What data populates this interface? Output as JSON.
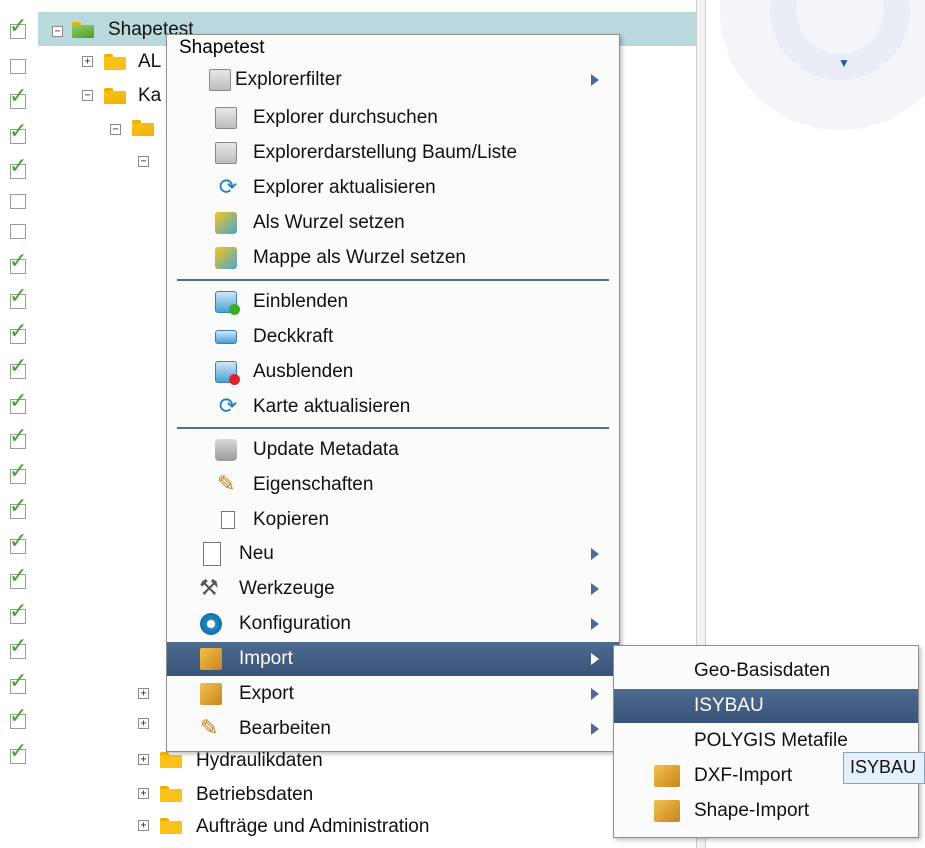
{
  "tree": {
    "root_label": "Shapetest",
    "items": [
      {
        "label": "AL",
        "checked": false
      },
      {
        "label": "Ka",
        "checked": true
      },
      {
        "label": "Hydraulikdaten"
      },
      {
        "label": "Betriebsdaten"
      },
      {
        "label": "Aufträge und Administration"
      }
    ]
  },
  "context_menu": {
    "title": "Shapetest",
    "group1": [
      {
        "label": "Explorerfilter",
        "icon": "filter-icon"
      },
      {
        "label": "Explorer durchsuchen",
        "icon": "search-filter-icon"
      },
      {
        "label": "Explorerdarstellung Baum/Liste",
        "icon": "tree-list-icon"
      },
      {
        "label": "Explorer aktualisieren",
        "icon": "refresh-icon"
      },
      {
        "label": "Als Wurzel setzen",
        "icon": "set-root-icon"
      },
      {
        "label": "Mappe als Wurzel setzen",
        "icon": "folder-root-icon"
      }
    ],
    "group2": [
      {
        "label": "Einblenden",
        "icon": "show-layer-icon"
      },
      {
        "label": "Deckkraft",
        "icon": "opacity-icon"
      },
      {
        "label": "Ausblenden",
        "icon": "hide-layer-icon"
      },
      {
        "label": "Karte aktualisieren",
        "icon": "refresh-map-icon"
      }
    ],
    "group3": [
      {
        "label": "Update Metadata",
        "icon": "database-icon"
      },
      {
        "label": "Eigenschaften",
        "icon": "properties-icon"
      },
      {
        "label": "Kopieren",
        "icon": "copy-icon"
      },
      {
        "label": "Neu",
        "icon": "new-page-icon"
      },
      {
        "label": "Werkzeuge",
        "icon": "tools-icon"
      },
      {
        "label": "Konfiguration",
        "icon": "configuration-icon"
      },
      {
        "label": "Import",
        "icon": "import-icon"
      },
      {
        "label": "Export",
        "icon": "export-icon"
      },
      {
        "label": "Bearbeiten",
        "icon": "edit-icon"
      }
    ]
  },
  "import_submenu": {
    "items": [
      {
        "label": "Geo-Basisdaten"
      },
      {
        "label": "ISYBAU"
      },
      {
        "label": "POLYGIS Metafile"
      },
      {
        "label": "DXF-Import",
        "icon": "dxf-import-icon"
      },
      {
        "label": "Shape-Import",
        "icon": "shape-import-icon"
      }
    ]
  },
  "tooltip": {
    "text": "ISYBAU"
  },
  "colors": {
    "selection": "#b9d9dd",
    "menu_highlight": "#46607f",
    "check_green": "#3fa82a"
  }
}
